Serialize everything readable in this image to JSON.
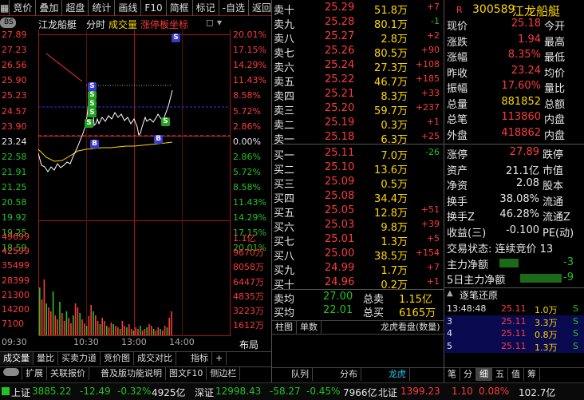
{
  "topbar": {
    "items": [
      "竞价",
      "叠加",
      "超盘",
      "统计",
      "画线",
      "F10",
      "简框",
      "标记",
      "-自选",
      "返回"
    ]
  },
  "chart_header": {
    "name": "江龙船艇",
    "mode": "分时",
    "vol_label": "成交量",
    "limit_label": "涨停板坐标",
    "toggle": "BS"
  },
  "price_axis": {
    "left": [
      "27.89",
      "27.23",
      "26.56",
      "25.90",
      "25.23",
      "24.57",
      "23.90",
      "23.24",
      "22.58",
      "21.91",
      "21.25",
      "20.58",
      "19.92",
      "19.25",
      "18.59"
    ],
    "right": [
      "20.01%",
      "17.15%",
      "14.29%",
      "11.43%",
      "8.58%",
      "5.72%",
      "2.86%",
      "0.00%",
      "2.86%",
      "5.72%",
      "8.58%",
      "11.43%",
      "14.29%",
      "17.15%",
      "20.01%"
    ]
  },
  "volume_axis": {
    "left": [
      "49699",
      "42599",
      "35499",
      "28399",
      "21300",
      "14200",
      "7100"
    ],
    "right": [
      "1.1亿",
      "9670万",
      "8058万",
      "6447万",
      "4835万",
      "3223万",
      "1612万"
    ]
  },
  "time_axis": [
    "09:30",
    "10:30",
    "13:00",
    "14:00"
  ],
  "time_layout_label": "布局",
  "chart_tabs": [
    "成交量",
    "量比",
    "买卖力道",
    "竞价图",
    "成交对比",
    "指标",
    "+"
  ],
  "bottom_tabs": [
    "扩展",
    "关联报价",
    "普及版功能说明",
    "图文F10",
    "侧边栏"
  ],
  "order_book": {
    "sells": [
      {
        "label": "卖十",
        "price": "25.29",
        "vol": "51.8万",
        "chg": "+7"
      },
      {
        "label": "卖九",
        "price": "25.28",
        "vol": "80.1万",
        "chg": "-1"
      },
      {
        "label": "卖八",
        "price": "25.27",
        "vol": "2.8万",
        "chg": "+2"
      },
      {
        "label": "卖七",
        "price": "25.26",
        "vol": "80.5万",
        "chg": "+90"
      },
      {
        "label": "卖六",
        "price": "25.24",
        "vol": "27.3万",
        "chg": "+108"
      },
      {
        "label": "卖五",
        "price": "25.22",
        "vol": "46.7万",
        "chg": "+185"
      },
      {
        "label": "卖四",
        "price": "25.21",
        "vol": "8.3万",
        "chg": "+33"
      },
      {
        "label": "卖三",
        "price": "25.20",
        "vol": "59.7万",
        "chg": "+237"
      },
      {
        "label": "卖二",
        "price": "25.19",
        "vol": "0.3万",
        "chg": "+1"
      },
      {
        "label": "卖一",
        "price": "25.18",
        "vol": "6.3万",
        "chg": "+25"
      }
    ],
    "buys": [
      {
        "label": "买一",
        "price": "25.11",
        "vol": "7.0万",
        "chg": "-26"
      },
      {
        "label": "买二",
        "price": "25.10",
        "vol": "13.6万",
        "chg": ""
      },
      {
        "label": "买三",
        "price": "25.09",
        "vol": "0.5万",
        "chg": ""
      },
      {
        "label": "买四",
        "price": "25.08",
        "vol": "34.4万",
        "chg": ""
      },
      {
        "label": "买五",
        "price": "25.05",
        "vol": "12.8万",
        "chg": "+51"
      },
      {
        "label": "买六",
        "price": "25.03",
        "vol": "9.8万",
        "chg": "+39"
      },
      {
        "label": "买七",
        "price": "25.01",
        "vol": "1.3万",
        "chg": "+5"
      },
      {
        "label": "买八",
        "price": "25.00",
        "vol": "38.5万",
        "chg": "+154"
      },
      {
        "label": "买九",
        "price": "24.99",
        "vol": "1.7万",
        "chg": "+7"
      },
      {
        "label": "买十",
        "price": "24.96",
        "vol": "0.2万",
        "chg": "+1"
      }
    ],
    "summary": {
      "sell_avg_label": "卖均",
      "sell_avg": "27.00",
      "sell_total_label": "总卖",
      "sell_total": "1.15亿",
      "buy_avg_label": "买均",
      "buy_avg": "22.01",
      "buy_total_label": "总买",
      "buy_total": "6165万"
    },
    "tabs": [
      "柱图",
      "单数",
      "龙虎看盘(数量)"
    ]
  },
  "stock": {
    "code": "300589",
    "name": "江龙船艇",
    "flag": "R",
    "rows": [
      {
        "l1": "现价",
        "v1": "25.18",
        "l2": "今开"
      },
      {
        "l1": "涨跌",
        "v1": "1.94",
        "l2": "最高"
      },
      {
        "l1": "涨幅",
        "v1": "8.35%",
        "l2": "最低"
      },
      {
        "l1": "昨收",
        "v1": "23.24",
        "l2": "均价"
      },
      {
        "l1": "振幅",
        "v1": "17.60%",
        "l2": "量比"
      },
      {
        "l1": "总量",
        "v1": "881852",
        "l2": "总额"
      },
      {
        "l1": "总笔",
        "v1": "113860",
        "l2": "内盘"
      },
      {
        "l1": "外盘",
        "v1": "418862",
        "l2": "内盘"
      }
    ],
    "rows2": [
      {
        "l1": "涨停",
        "v1": "27.89",
        "l2": "跌停"
      },
      {
        "l1": "资产",
        "v1": "21.1亿",
        "l2": "市值"
      },
      {
        "l1": "净资",
        "v1": "2.08",
        "l2": "股本"
      },
      {
        "l1": "换手",
        "v1": "38.08%",
        "l2": "流通"
      },
      {
        "l1": "换手Z",
        "v1": "46.28%",
        "l2": "流通Z"
      },
      {
        "l1": "收益(三)",
        "v1": "-0.100",
        "l2": "PE(动)"
      }
    ],
    "trade_status": "交易状态: 连续竞价 13",
    "main_flow_label": "主力净额",
    "main_flow_val": "-3",
    "main_flow5_label": "5日主力净额",
    "main_flow5_val": "-9",
    "ticks_title": "逐笔还原",
    "ticks": [
      {
        "t": "13:48:48",
        "p": "25.11",
        "v": "1.0万",
        "s": "S"
      },
      {
        "t": "3",
        "p": "25.11",
        "v": "3.3万",
        "s": "S"
      },
      {
        "t": "4",
        "p": "25.11",
        "v": "0.8万",
        "s": "S"
      },
      {
        "t": "5",
        "p": "25.11",
        "v": "1.3万",
        "s": "S"
      }
    ],
    "bottom_tabs": [
      "队列",
      "分布",
      "龙虎",
      "笔",
      "分",
      "细",
      "五",
      "值",
      "筹"
    ]
  },
  "statusbar": {
    "sh_label": "上证",
    "sh_val": "3885.22",
    "sh_chg": "-12.49",
    "sh_pct": "-0.32%",
    "sh_amt": "4925亿",
    "sz_label": "深证",
    "sz_val": "12998.43",
    "sz_chg": "-58.27",
    "sz_pct": "-0.45%",
    "sz_amt": "7966亿",
    "bz_label": "北证",
    "bz_val": "1399.23",
    "bz_chg": "1.10",
    "bz_pct": "0.08%",
    "bz_amt": "102.7亿"
  },
  "colors": {
    "up": "#ff3b3b",
    "down": "#22c322",
    "grid": "#7a1414",
    "accent": "#ffd700"
  }
}
